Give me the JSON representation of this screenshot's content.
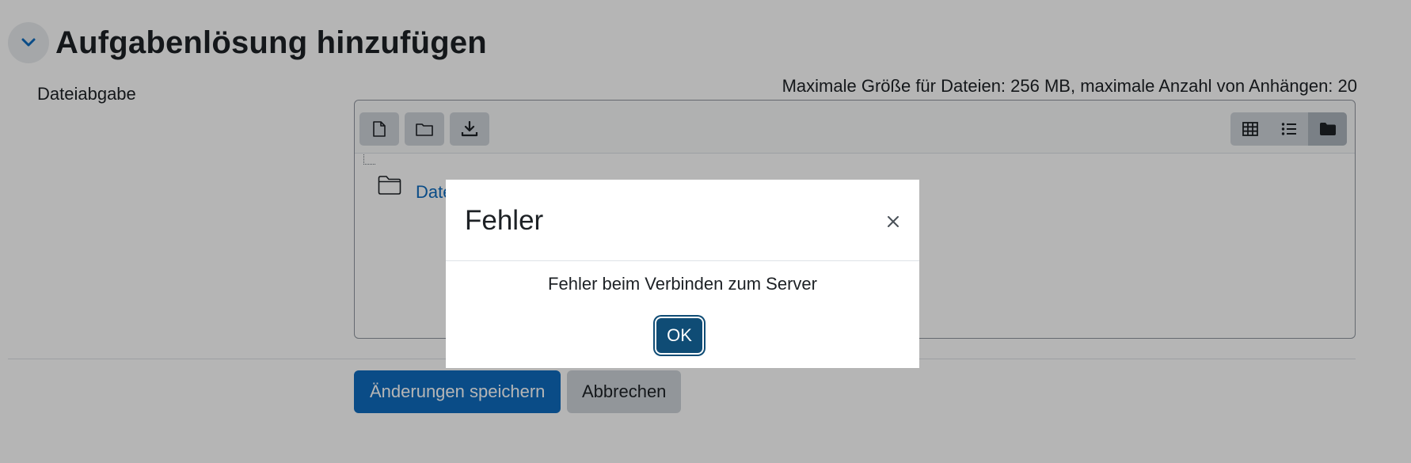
{
  "section": {
    "title": "Aufgabenlösung hinzufügen",
    "collapse_icon": "chevron-down-icon"
  },
  "field": {
    "label": "Dateiabgabe",
    "limits": "Maximale Größe für Dateien: 256 MB, maximale Anzahl von Anhängen: 20"
  },
  "filemanager": {
    "toolbar_icons": [
      "add-file-icon",
      "create-folder-icon",
      "download-icon"
    ],
    "view_icons": [
      "grid-view-icon",
      "list-view-icon",
      "tree-view-icon"
    ],
    "active_view": "tree-view-icon",
    "folder_name": "Dateien"
  },
  "buttons": {
    "save": "Änderungen speichern",
    "cancel": "Abbrechen"
  },
  "modal": {
    "title": "Fehler",
    "message": "Fehler beim Verbinden zum Server",
    "ok": "OK",
    "close_icon": "close-icon"
  },
  "colors": {
    "primary": "#0f6cbf",
    "modal_ok": "#0f4c75",
    "secondary_button": "#ced4da",
    "backdrop": "rgba(0,0,0,0.29)"
  }
}
